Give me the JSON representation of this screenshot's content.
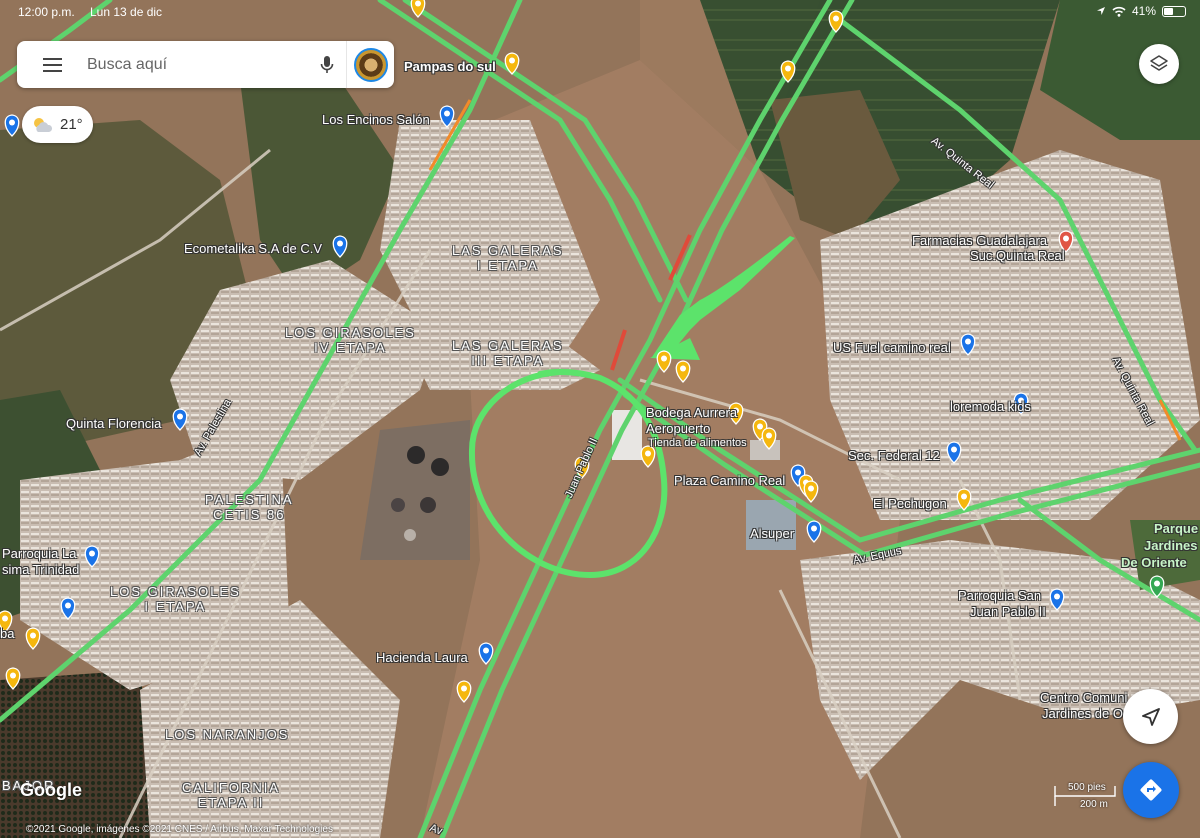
{
  "status_bar": {
    "time": "12:00 p.m.",
    "date": "Lun 13 de dic",
    "battery": "41%",
    "battery_level": 0.41
  },
  "search": {
    "placeholder": "Busca aquí"
  },
  "weather": {
    "temperature": "21°"
  },
  "places": [
    {
      "name": "Pampas do sul"
    },
    {
      "name": "Los Encinos Salón"
    },
    {
      "name": "Ecometalika S.A de C.V"
    },
    {
      "name": "Farmacias Guadalajara"
    },
    {
      "name": "Suc.Quinta Real"
    },
    {
      "name": "US Fuel camino real"
    },
    {
      "name": "loremoda kids"
    },
    {
      "name": "Bodega Aurrera"
    },
    {
      "name": "Aeropuerto"
    },
    {
      "name": "Tienda de alimentos"
    },
    {
      "name": "Sec. Federal 12"
    },
    {
      "name": "Plaza Camino Real"
    },
    {
      "name": "El Pechugon"
    },
    {
      "name": "Alsuper"
    },
    {
      "name": "Quinta Florencia"
    },
    {
      "name": "Parroquia La"
    },
    {
      "name": "sima Trinidad"
    },
    {
      "name": "Hacienda Laura"
    },
    {
      "name": "Parroquia San"
    },
    {
      "name": "Juan Pablo II"
    },
    {
      "name": "Parque"
    },
    {
      "name": "Jardines"
    },
    {
      "name": "De Oriente"
    },
    {
      "name": "Centro Comuni"
    },
    {
      "name": "Jardines de O"
    },
    {
      "name": "ba"
    }
  ],
  "areas": [
    {
      "line1": "LAS GALERAS",
      "line2": "I ETAPA"
    },
    {
      "line1": "LOS GIRASOLES",
      "line2": "IV ETAPA"
    },
    {
      "line1": "LAS GALERAS",
      "line2": "III ETAPA"
    },
    {
      "line1": "PALESTINA",
      "line2": "CETIS 86"
    },
    {
      "line1": "LOS GIRASOLES",
      "line2": "I ETAPA"
    },
    {
      "line1": "LOS NARANJOS",
      "line2": ""
    },
    {
      "line1": "CALIFORNIA",
      "line2": "ETAPA II"
    },
    {
      "line1": "BAJOR",
      "line2": ""
    }
  ],
  "roads": [
    {
      "name": "Av. Quinta Real"
    },
    {
      "name": "Av. Quinta Real"
    },
    {
      "name": "Av. Palestina"
    },
    {
      "name": "Juan Pablo II"
    },
    {
      "name": "Av. Equus"
    },
    {
      "name": "Av"
    }
  ],
  "attribution": {
    "logo": "Google",
    "copyright": "©2021 Google, imágenes ©2021 CNES / Airbus, Maxar Technologies"
  },
  "scale": {
    "imperial": "500 pies",
    "metric": "200 m"
  },
  "controls": {
    "layers_icon": "layers-icon",
    "locate_icon": "compass-icon",
    "directions_icon": "directions-icon"
  },
  "colors": {
    "traffic_green": "#5ed36d",
    "annotation_green": "#5ce36b",
    "pin_yellow": "#f5b70e",
    "pin_blue": "#1a73e8",
    "directions_blue": "#1a73e8"
  }
}
